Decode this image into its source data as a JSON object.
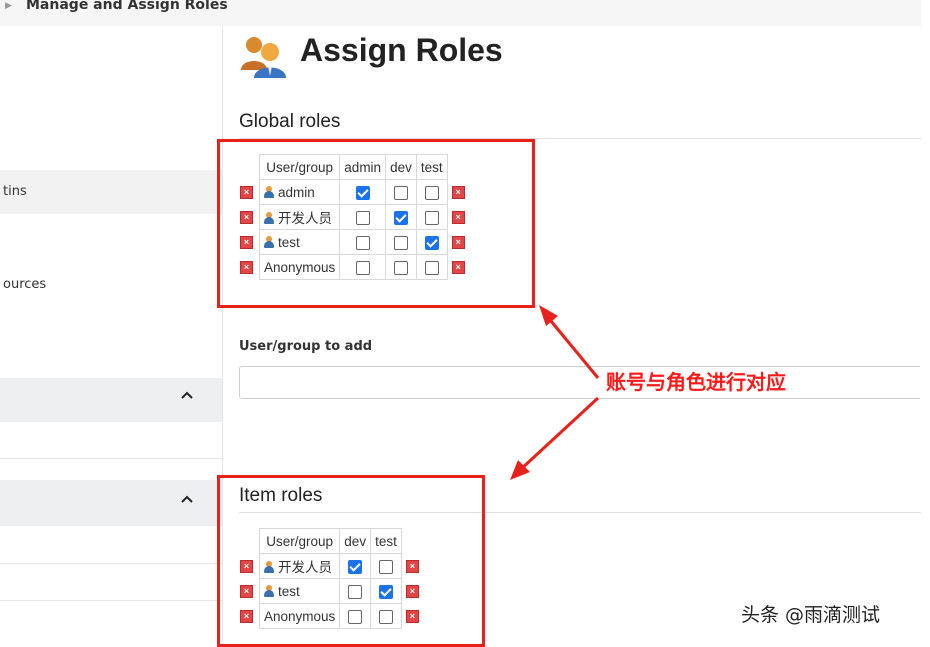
{
  "breadcrumb": {
    "label": "Manage and Assign Roles"
  },
  "sidebar": {
    "items": [
      {
        "label": "tins"
      },
      {
        "label": "ources"
      }
    ]
  },
  "page": {
    "title": "Assign Roles"
  },
  "global_roles": {
    "heading": "Global roles",
    "columns": [
      "User/group",
      "admin",
      "dev",
      "test"
    ],
    "rows": [
      {
        "name": "admin",
        "user_icon": true,
        "checks": [
          true,
          false,
          false
        ]
      },
      {
        "name": "开发人员",
        "user_icon": true,
        "checks": [
          false,
          true,
          false
        ]
      },
      {
        "name": "test",
        "user_icon": true,
        "checks": [
          false,
          false,
          true
        ]
      },
      {
        "name": "Anonymous",
        "user_icon": false,
        "checks": [
          false,
          false,
          false
        ]
      }
    ]
  },
  "add_user": {
    "label": "User/group to add",
    "value": ""
  },
  "item_roles": {
    "heading": "Item roles",
    "columns": [
      "User/group",
      "dev",
      "test"
    ],
    "rows": [
      {
        "name": "开发人员",
        "user_icon": true,
        "checks": [
          true,
          false
        ]
      },
      {
        "name": "test",
        "user_icon": true,
        "checks": [
          false,
          true
        ]
      },
      {
        "name": "Anonymous",
        "user_icon": false,
        "checks": [
          false,
          false
        ]
      }
    ]
  },
  "annotation": {
    "text": "账号与角色进行对应",
    "color": "#ff1a1a"
  },
  "watermark": {
    "text": "头条 @雨滴测试"
  },
  "icons": {
    "delete": "delete-x-icon",
    "user": "user-icon",
    "title": "users-group-icon",
    "expand": "chevron-up-icon"
  }
}
